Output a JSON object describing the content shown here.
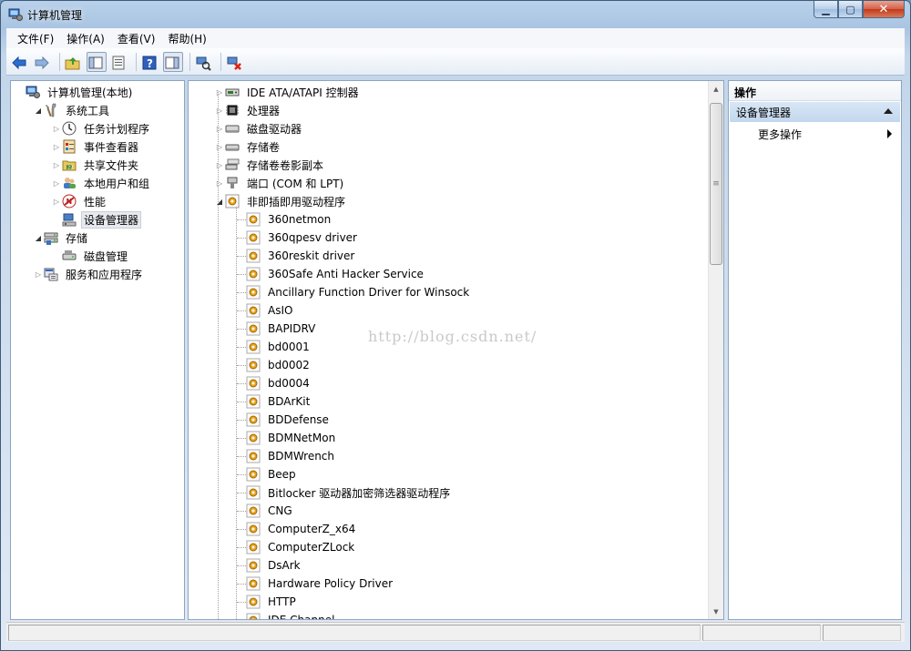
{
  "window": {
    "title": "计算机管理",
    "icons": {
      "app": "computer-management-icon",
      "minimize": "minimize-icon",
      "maximize": "maximize-icon",
      "close": "close-icon"
    }
  },
  "menu": [
    "文件(F)",
    "操作(A)",
    "查看(V)",
    "帮助(H)"
  ],
  "toolbar": [
    {
      "icon": "back-arrow-icon"
    },
    {
      "icon": "forward-arrow-icon"
    },
    {
      "sep": true
    },
    {
      "icon": "up-folder-icon"
    },
    {
      "icon": "show-hide-tree-icon",
      "pressed": true
    },
    {
      "icon": "properties-icon"
    },
    {
      "sep": true
    },
    {
      "icon": "help-icon"
    },
    {
      "icon": "show-hide-action-pane-icon",
      "pressed": true
    },
    {
      "sep": true
    },
    {
      "icon": "scan-hardware-icon"
    },
    {
      "sep": true
    },
    {
      "icon": "uninstall-device-icon"
    }
  ],
  "left_tree": [
    {
      "label": "计算机管理(本地)",
      "level": 0,
      "expander": "none",
      "icon": "computer-management-icon"
    },
    {
      "label": "系统工具",
      "level": 1,
      "expander": "open",
      "icon": "system-tools-icon"
    },
    {
      "label": "任务计划程序",
      "level": 2,
      "expander": "closed",
      "icon": "task-scheduler-icon"
    },
    {
      "label": "事件查看器",
      "level": 2,
      "expander": "closed",
      "icon": "event-viewer-icon"
    },
    {
      "label": "共享文件夹",
      "level": 2,
      "expander": "closed",
      "icon": "shared-folders-icon"
    },
    {
      "label": "本地用户和组",
      "level": 2,
      "expander": "closed",
      "icon": "local-users-icon"
    },
    {
      "label": "性能",
      "level": 2,
      "expander": "closed",
      "icon": "performance-icon"
    },
    {
      "label": "设备管理器",
      "level": 2,
      "expander": "none",
      "icon": "device-manager-icon",
      "selected": true
    },
    {
      "label": "存储",
      "level": 1,
      "expander": "open",
      "icon": "storage-icon"
    },
    {
      "label": "磁盘管理",
      "level": 2,
      "expander": "none",
      "icon": "disk-management-icon"
    },
    {
      "label": "服务和应用程序",
      "level": 1,
      "expander": "closed",
      "icon": "services-applications-icon"
    }
  ],
  "device_tree": {
    "categories": [
      {
        "label": "IDE ATA/ATAPI 控制器",
        "expander": "closed",
        "icon": "ide-controller-icon"
      },
      {
        "label": "处理器",
        "expander": "closed",
        "icon": "processor-icon"
      },
      {
        "label": "磁盘驱动器",
        "expander": "closed",
        "icon": "disk-drive-icon"
      },
      {
        "label": "存储卷",
        "expander": "closed",
        "icon": "storage-volume-icon"
      },
      {
        "label": "存储卷卷影副本",
        "expander": "closed",
        "icon": "volume-shadow-copy-icon"
      },
      {
        "label": "端口 (COM 和 LPT)",
        "expander": "closed",
        "icon": "port-icon"
      },
      {
        "label": "非即插即用驱动程序",
        "expander": "open",
        "icon": "non-pnp-driver-icon"
      }
    ],
    "drivers": [
      "360netmon",
      "360qpesv driver",
      "360reskit driver",
      "360Safe Anti Hacker Service",
      "Ancillary Function Driver for Winsock",
      "AsIO",
      "BAPIDRV",
      "bd0001",
      "bd0002",
      "bd0004",
      "BDArKit",
      "BDDefense",
      "BDMNetMon",
      "BDMWrench",
      "Beep",
      "Bitlocker 驱动器加密筛选器驱动程序",
      "CNG",
      "ComputerZ_x64",
      "ComputerZLock",
      "DsArk",
      "Hardware Policy Driver",
      "HTTP",
      "IDE Channel"
    ],
    "driver_icon": "driver-gear-icon"
  },
  "watermark": "http://blog.csdn.net/",
  "actions": {
    "header": "操作",
    "section": "设备管理器",
    "more": "更多操作"
  }
}
